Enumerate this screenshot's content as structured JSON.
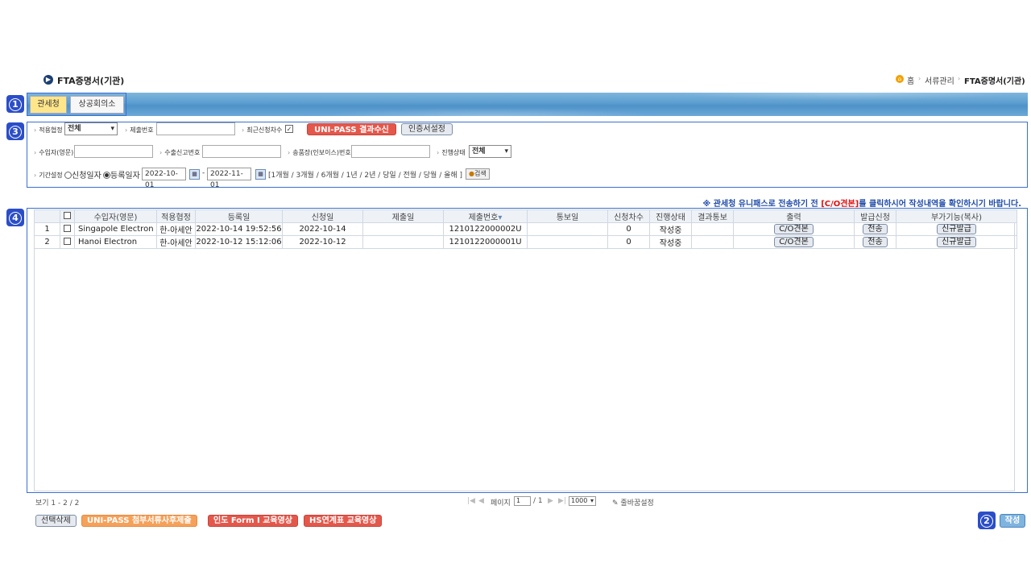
{
  "page": {
    "title": "FTA증명서(기관)",
    "breadcrumb": {
      "home": "홈",
      "level1": "서류관리",
      "level2": "FTA증명서(기관)"
    }
  },
  "markers": [
    "1",
    "2",
    "3",
    "4"
  ],
  "tabs": [
    {
      "label": "관세청",
      "active": true
    },
    {
      "label": "상공회의소",
      "active": false
    }
  ],
  "search": {
    "agreement_label": "적용협정",
    "agreement_value": "전체",
    "submit_no_label": "제출번호",
    "submit_no_value": "",
    "latest_round_label": "최근신청차수",
    "latest_round_checked": "✓",
    "unipass_button": "UNI-PASS 결과수신",
    "cert_button": "인증서설정",
    "importer_label": "수입자(영문)",
    "importer_value": "",
    "export_decl_label": "수출신고번호",
    "export_decl_value": "",
    "invoice_label": "송품장(인보이스)번호",
    "invoice_value": "",
    "status_label": "진행상태",
    "status_value": "전체",
    "period_label": "기간설정",
    "radio_apply": "신청일자",
    "radio_register": "등록일자",
    "date_from": "2022-10-01",
    "date_to": "2022-11-01",
    "date_separator": "-",
    "quick_periods": "[1개월 / 3개월 / 6개월 / 1년 / 2년 / 당일 / 전월 / 당월 / 올해 ]",
    "search_button": "검색"
  },
  "notice": {
    "before": "※ 관세청 유니패스로 전송하기 전 ",
    "highlight": "[C/O견본]",
    "after": "를 클릭하시어 작성내역을 확인하시기 바랍니다."
  },
  "grid": {
    "columns": [
      "수입자(영문)",
      "적용협정",
      "등록일",
      "신청일",
      "제출일",
      "제출번호",
      "통보일",
      "신청차수",
      "진행상태",
      "결과통보",
      "출력",
      "발급신청",
      "부가기능(복사)"
    ],
    "sort_indicator": "▾",
    "rows": [
      {
        "num": "1",
        "importer": "Singapole Electron",
        "agreement": "한-아세안",
        "registered": "2022-10-14 19:52:56",
        "applied": "2022-10-14",
        "submitted": "",
        "submit_no": "1210122000002U",
        "notified": "",
        "round": "0",
        "status": "작성중",
        "result": "",
        "print": "C/O견본",
        "issue": "전송",
        "copy": "신규발급"
      },
      {
        "num": "2",
        "importer": "Hanoi Electron",
        "agreement": "한-아세안",
        "registered": "2022-10-12 15:12:06",
        "applied": "2022-10-12",
        "submitted": "",
        "submit_no": "1210122000001U",
        "notified": "",
        "round": "0",
        "status": "작성중",
        "result": "",
        "print": "C/O견본",
        "issue": "전송",
        "copy": "신규발급"
      }
    ]
  },
  "pager": {
    "view_count": "보기 1 - 2 / 2",
    "page_label": "페이지",
    "page_value": "1",
    "page_total": "/ 1",
    "page_size": "1000",
    "column_settings": "줄바꿈설정",
    "nav_first": "|◀",
    "nav_prev": "◀",
    "nav_next": "▶",
    "nav_last": "▶|"
  },
  "bottom": {
    "delete_selected": "선택삭제",
    "unipass_attach": "UNI-PASS 첨부서류사후제출",
    "india_form": "인도 Form I 교육영상",
    "hs_table": "HS연계표 교육영상",
    "write": "작성"
  },
  "colors": {
    "marker": "#2b4ec8",
    "red_button": "#e4584c",
    "orange_button": "#f6a15a",
    "notice": "#1f4aa8"
  }
}
